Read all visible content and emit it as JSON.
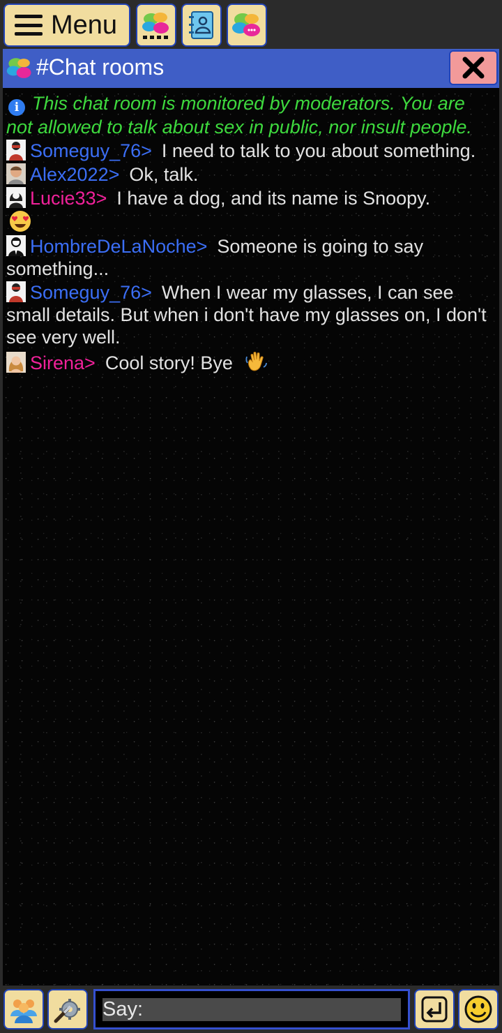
{
  "toolbar": {
    "menu_label": "Menu"
  },
  "window": {
    "title": "#Chat rooms",
    "close_glyph": "✕"
  },
  "chat": {
    "notice": "This chat room is monitored by moderators. You are not allowed to talk about sex in public, nor insult people.",
    "messages": [
      {
        "user": "Someguy_76>",
        "text": "I need to talk to you about something.",
        "user_color": "#3b6ef5",
        "avatar": "masked-avatar-icon"
      },
      {
        "user": "Alex2022>",
        "text": "Ok, talk.",
        "user_color": "#3b6ef5",
        "avatar": "man-photo-avatar-icon"
      },
      {
        "user": "Lucie33>",
        "text": "I have a dog, and its name is Snoopy.",
        "emoji": "heart-eyes-emoji-icon",
        "user_color": "#f0219a",
        "avatar": "woman-avatar-icon"
      },
      {
        "user": "HombreDeLaNoche>",
        "text": "Someone is going to say something...",
        "user_color": "#3b6ef5",
        "avatar": "suit-man-avatar-icon"
      },
      {
        "user": "Someguy_76>",
        "text": "When I wear my glasses, I can see small details. But when i don't have my glasses on, I don't see very well.",
        "user_color": "#3b6ef5",
        "avatar": "masked-avatar-icon"
      },
      {
        "user": "Sirena>",
        "text": "Cool story! Bye",
        "emoji": "waving-hand-emoji-icon",
        "user_color": "#f0219a",
        "avatar": "woman-photo-avatar-icon"
      }
    ]
  },
  "composer": {
    "placeholder": "Say:"
  },
  "colors": {
    "button_bg": "#f1dd9f",
    "button_border": "#2143b8",
    "titlebar_bg": "#3f5ec6",
    "close_bg": "#f29a9a",
    "notice_green": "#3ed93e",
    "user_blue": "#3b6ef5",
    "user_pink": "#f0219a"
  }
}
